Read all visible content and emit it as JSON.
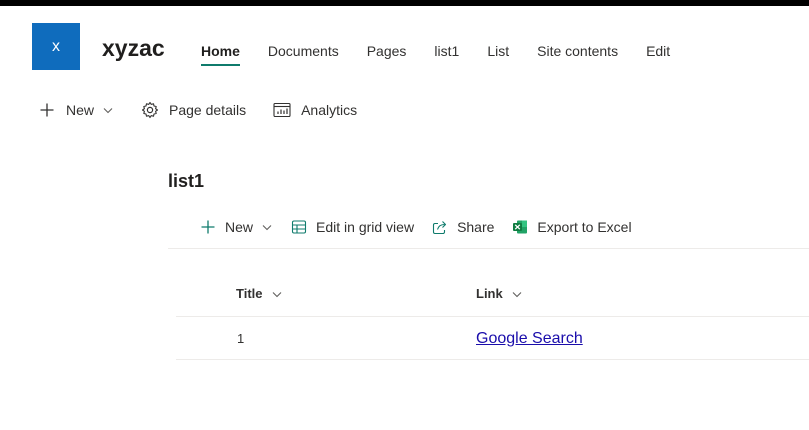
{
  "site": {
    "logo_letter": "x",
    "name": "xyzac",
    "logo_color": "#0f6cbd"
  },
  "nav": {
    "items": [
      {
        "label": "Home",
        "active": true
      },
      {
        "label": "Documents"
      },
      {
        "label": "Pages"
      },
      {
        "label": "list1"
      },
      {
        "label": "List"
      },
      {
        "label": "Site contents"
      },
      {
        "label": "Edit"
      }
    ],
    "active_underline_color": "#0f7b6c"
  },
  "page_commands": {
    "new_label": "New",
    "page_details_label": "Page details",
    "analytics_label": "Analytics",
    "icons": [
      "plus-icon",
      "chevron-down-icon",
      "gear-icon",
      "analytics-icon"
    ]
  },
  "list": {
    "title": "list1",
    "commands": {
      "new_label": "New",
      "grid_label": "Edit in grid view",
      "share_label": "Share",
      "export_label": "Export to Excel",
      "icons": [
        "plus-icon",
        "chevron-down-icon",
        "grid-icon",
        "share-icon",
        "excel-icon"
      ]
    },
    "columns": [
      {
        "label": "Title"
      },
      {
        "label": "Link"
      }
    ],
    "rows": [
      {
        "title": "1",
        "link": "Google Search"
      }
    ],
    "link_color": "#1a0dab",
    "accent_color": "#0f7b6c"
  }
}
